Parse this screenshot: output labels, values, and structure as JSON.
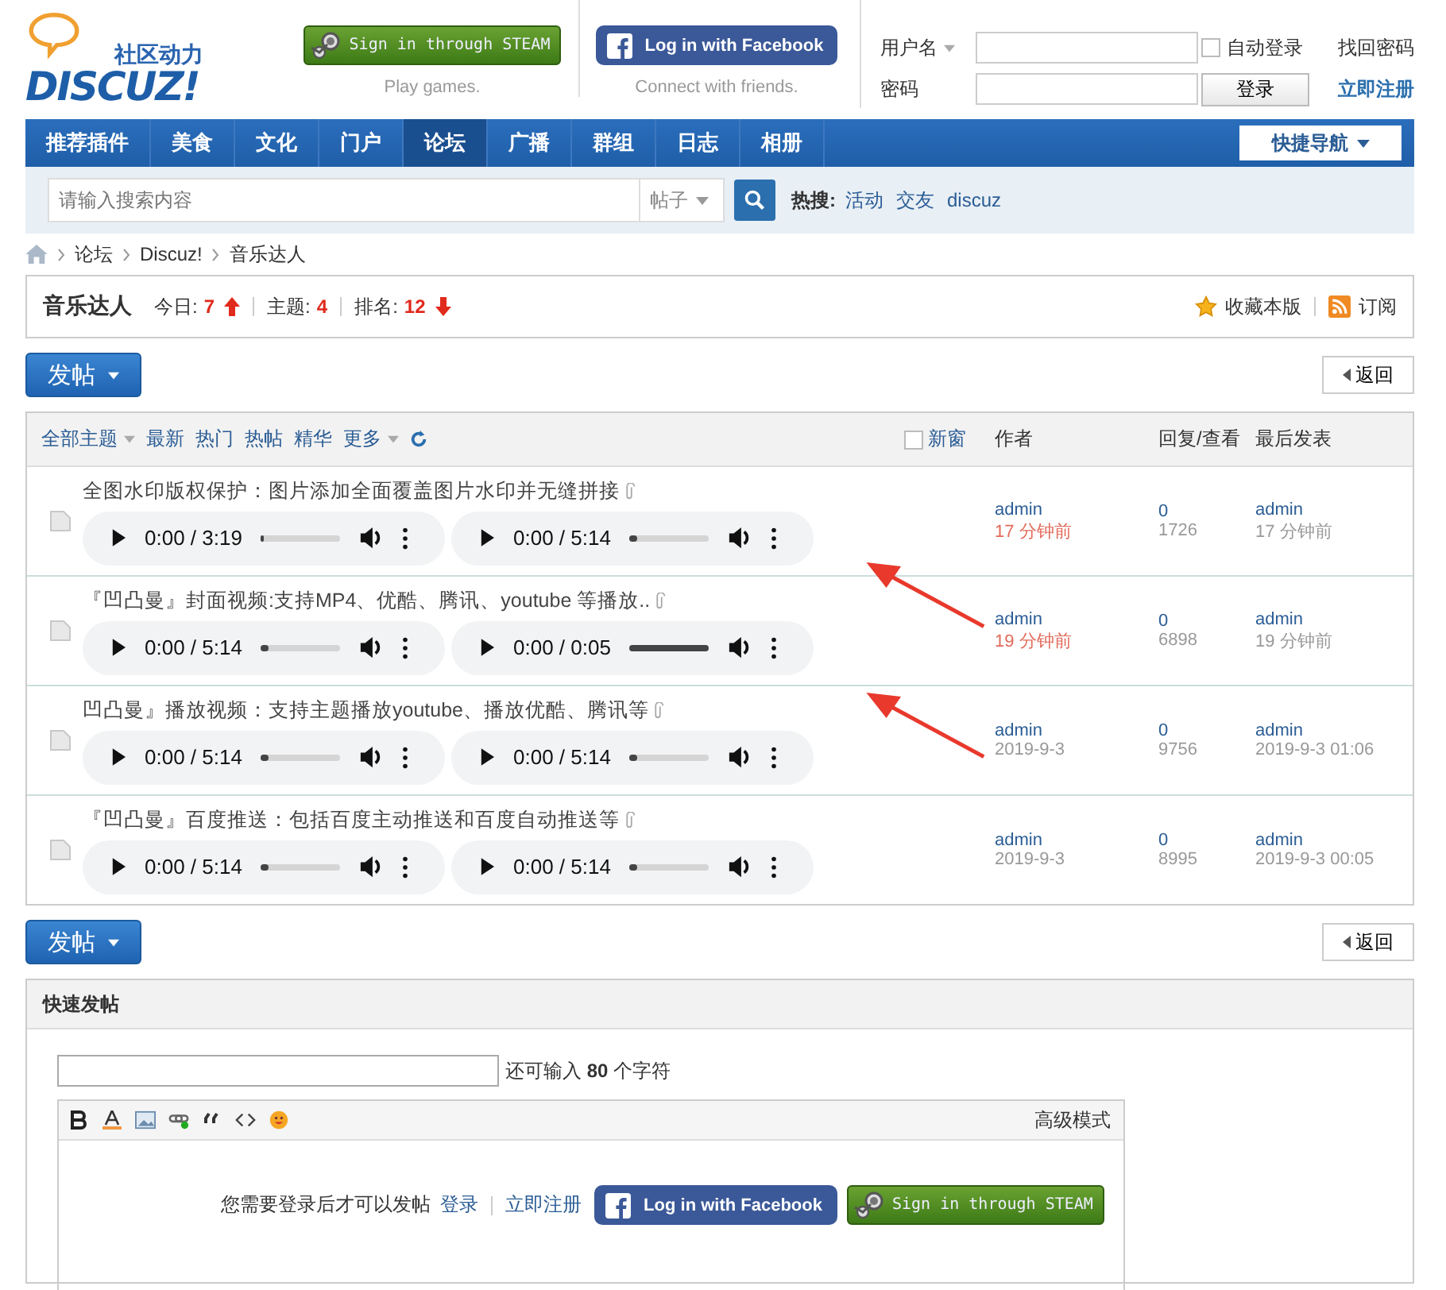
{
  "logo": {
    "tagline": "社区动力",
    "wordmark": "DISCUZ!"
  },
  "social": [
    {
      "kind": "steam",
      "label": "Sign in through STEAM",
      "caption": "Play games."
    },
    {
      "kind": "facebook",
      "label": "Log in with Facebook",
      "caption": "Connect with friends."
    }
  ],
  "login": {
    "username_label": "用户名",
    "password_label": "密码",
    "remember_label": "自动登录",
    "remember_checked": false,
    "submit": "登录",
    "forgot": "找回密码",
    "register": "立即注册"
  },
  "nav": {
    "items": [
      {
        "label": "推荐插件",
        "selected": false
      },
      {
        "label": "美食",
        "selected": false
      },
      {
        "label": "文化",
        "selected": false
      },
      {
        "label": "门户",
        "selected": false
      },
      {
        "label": "论坛",
        "selected": true
      },
      {
        "label": "广播",
        "selected": false
      },
      {
        "label": "群组",
        "selected": false
      },
      {
        "label": "日志",
        "selected": false
      },
      {
        "label": "相册",
        "selected": false
      }
    ],
    "quick_nav": "快捷导航"
  },
  "search": {
    "placeholder": "请输入搜索内容",
    "scope": "帖子",
    "hot_label": "热搜:",
    "hot": [
      "活动",
      "交友",
      "discuz"
    ]
  },
  "breadcrumb": [
    "论坛",
    "Discuz!",
    "音乐达人"
  ],
  "forum": {
    "name": "音乐达人",
    "today_label": "今日:",
    "today": "7",
    "today_up": true,
    "topics_label": "主题:",
    "topics": "4",
    "rank_label": "排名:",
    "rank": "12",
    "rank_up": false,
    "favorite": "收藏本版",
    "subscribe": "订阅"
  },
  "top_actions": {
    "post_button": "发帖",
    "back_button": "返回"
  },
  "list_header": {
    "filters": [
      {
        "label": "全部主题",
        "dropdown": true
      },
      {
        "label": "最新",
        "dropdown": false
      },
      {
        "label": "热门",
        "dropdown": false
      },
      {
        "label": "热帖",
        "dropdown": false
      },
      {
        "label": "精华",
        "dropdown": false
      },
      {
        "label": "更多",
        "dropdown": true
      }
    ],
    "new_window": "新窗",
    "new_window_checked": false,
    "author": "作者",
    "replies_views": "回复/查看",
    "last_post": "最后发表"
  },
  "threads": [
    {
      "title": "全图水印版权保护：图片添加全面覆盖图片水印并无缝拼接",
      "author": "admin",
      "date": "17 分钟前",
      "recent": true,
      "replies": "0",
      "views": "1726",
      "last_user": "admin",
      "last_time": "17 分钟前",
      "players": [
        {
          "time": "0:00 / 3:19",
          "level": 0
        },
        {
          "time": "0:00 / 5:14",
          "level": 0.1
        }
      ]
    },
    {
      "title": "『凹凸曼』封面视频:支持MP4、优酷、腾讯、youtube 等播放..",
      "author": "admin",
      "date": "19 分钟前",
      "recent": true,
      "replies": "0",
      "views": "6898",
      "last_user": "admin",
      "last_time": "19 分钟前",
      "players": [
        {
          "time": "0:00 / 5:14",
          "level": 0.1
        },
        {
          "time": "0:00 / 0:05",
          "level": 1
        }
      ]
    },
    {
      "title": "凹凸曼』播放视频：支持主题播放youtube、播放优酷、腾讯等",
      "author": "admin",
      "date": "2019-9-3",
      "recent": false,
      "replies": "0",
      "views": "9756",
      "last_user": "admin",
      "last_time": "2019-9-3 01:06",
      "players": [
        {
          "time": "0:00 / 5:14",
          "level": 0.1
        },
        {
          "time": "0:00 / 5:14",
          "level": 0.1
        }
      ]
    },
    {
      "title": "『凹凸曼』百度推送：包括百度主动推送和百度自动推送等",
      "author": "admin",
      "date": "2019-9-3",
      "recent": false,
      "replies": "0",
      "views": "8995",
      "last_user": "admin",
      "last_time": "2019-9-3 00:05",
      "players": [
        {
          "time": "0:00 / 5:14",
          "level": 0.1
        },
        {
          "time": "0:00 / 5:14",
          "level": 0.1
        }
      ]
    }
  ],
  "annotation_arrows": [
    {
      "kind": "arrow"
    },
    {
      "kind": "arrow"
    }
  ],
  "bottom_actions": {
    "post_button": "发帖",
    "back_button": "返回"
  },
  "quick_post": {
    "title": "快速发帖",
    "remaining_before": "还可输入",
    "remaining": "80",
    "remaining_after": "个字符",
    "advanced": "高级模式",
    "login_notice": "您需要登录后才可以发帖",
    "login_link": "登录",
    "register_link": "立即注册",
    "facebook_label": "Log in with Facebook",
    "steam_label": "Sign in through STEAM"
  }
}
